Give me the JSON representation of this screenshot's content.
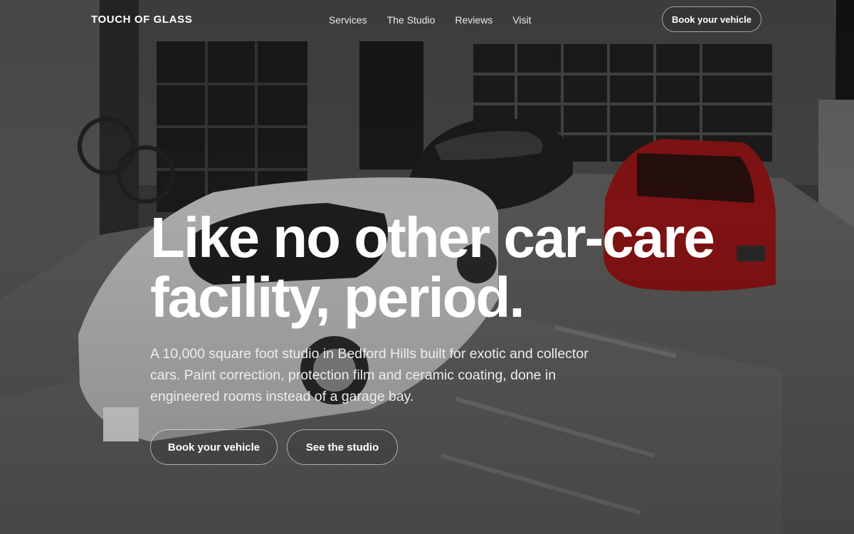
{
  "header": {
    "brand": "TOUCH OF GLASS",
    "nav": [
      {
        "label": "Services"
      },
      {
        "label": "The Studio"
      },
      {
        "label": "Reviews"
      },
      {
        "label": "Visit"
      }
    ],
    "cta_label": "Book your vehicle"
  },
  "hero": {
    "title_line1": "Like no other car-care",
    "title_line2": "facility, period.",
    "subtitle": "A 10,000 square foot studio in Bedford Hills built for exotic and collector cars. Paint correction, protection film and ceramic coating, done in engineered rooms instead of a garage bay.",
    "primary_cta": "Book your vehicle",
    "secondary_cta": "See the studio"
  }
}
